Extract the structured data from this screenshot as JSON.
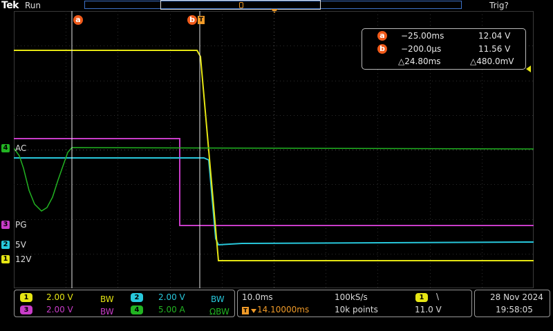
{
  "status": {
    "brand": "Tek",
    "run_state": "Run",
    "trigger_state": "Trig?"
  },
  "cursors": {
    "a_label": "a",
    "b_label": "b",
    "trigger_marker": "T"
  },
  "readout": {
    "a_time": "−25.00ms",
    "a_value": "12.04 V",
    "b_time": "−200.0µs",
    "b_value": "11.56 V",
    "delta_time": "△24.80ms",
    "delta_value": "△480.0mV"
  },
  "channel_markers": [
    {
      "num": "4",
      "label": "AC",
      "color": "#22b422"
    },
    {
      "num": "3",
      "label": "PG",
      "color": "#c83cc8"
    },
    {
      "num": "2",
      "label": "5V",
      "color": "#28c8dc"
    },
    {
      "num": "1",
      "label": "12V",
      "color": "#e6e614"
    }
  ],
  "channels": {
    "ch1": {
      "num": "1",
      "scale": "2.00 V",
      "bw": "BW",
      "color": "#e6e614"
    },
    "ch2": {
      "num": "2",
      "scale": "2.00 V",
      "bw": "BW",
      "color": "#28c8dc"
    },
    "ch3": {
      "num": "3",
      "scale": "2.00 V",
      "bw": "BW",
      "color": "#c83cc8"
    },
    "ch4": {
      "num": "4",
      "scale": "5.00 A",
      "bw": "ΩBW",
      "color": "#22b422"
    }
  },
  "timebase": {
    "scale": "10.0ms",
    "sample_rate": "100kS/s",
    "trigger_pos": "14.10000ms",
    "record_length": "10k points"
  },
  "trigger": {
    "source": "1",
    "slope": "\\",
    "level": "11.0 V"
  },
  "datetime": {
    "date": "28 Nov 2024",
    "time": "19:58:05"
  },
  "colors": {
    "cursor_badge": "#f05a1a",
    "trigger_orange": "#f09a28",
    "record_bar": "#3d72c8"
  }
}
